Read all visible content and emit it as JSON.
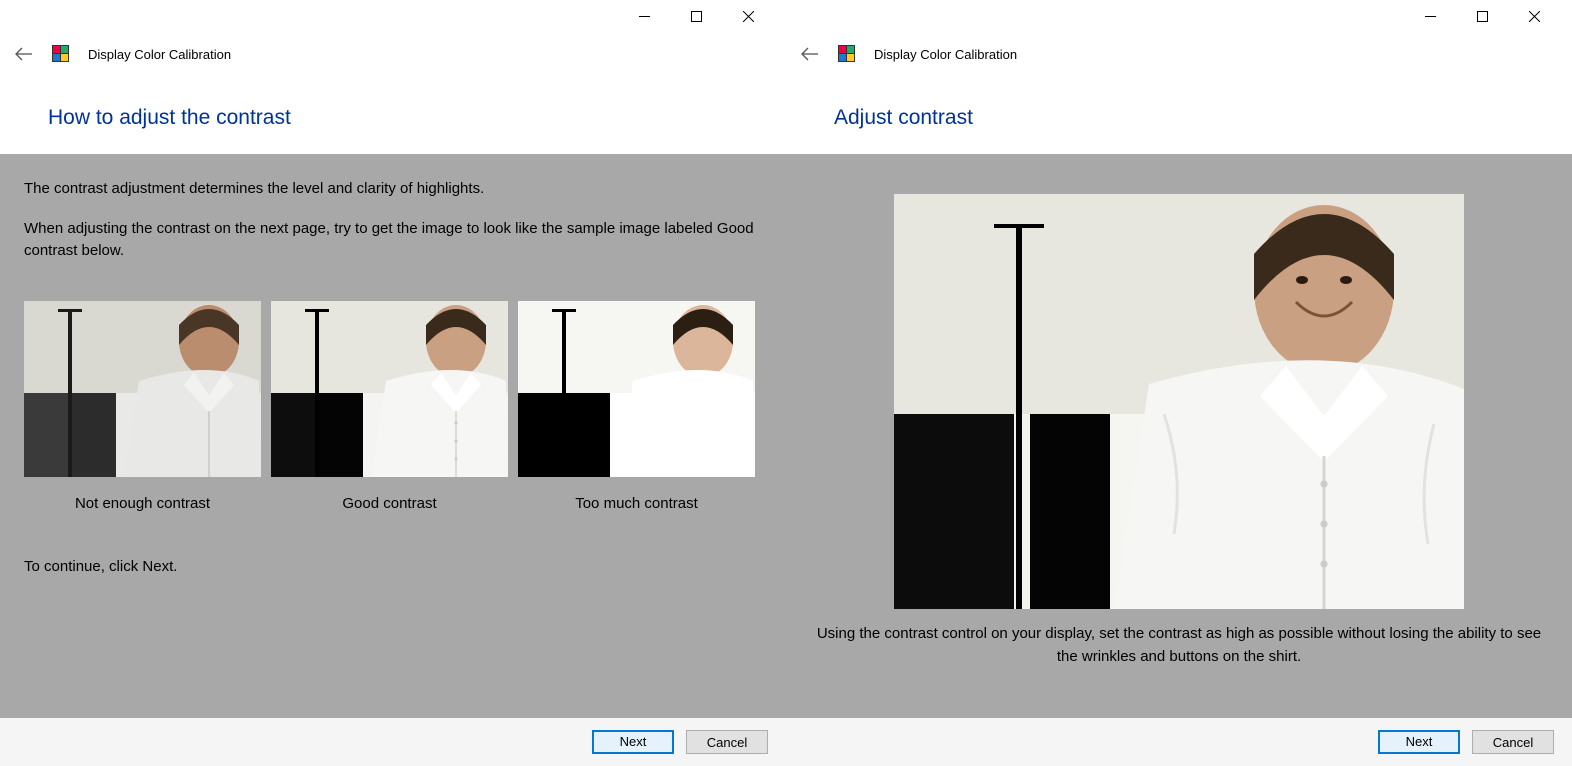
{
  "left": {
    "app_title": "Display Color Calibration",
    "heading": "How to adjust the contrast",
    "para1": "The contrast adjustment determines the level and clarity of highlights.",
    "para2": "When adjusting the contrast on the next page, try to get the image to look like the sample image labeled Good contrast below.",
    "samples": {
      "not_enough": "Not enough contrast",
      "good": "Good contrast",
      "too_much": "Too much contrast"
    },
    "continue_text": "To continue, click Next.",
    "next_label": "Next",
    "cancel_label": "Cancel"
  },
  "right": {
    "app_title": "Display Color Calibration",
    "heading": "Adjust contrast",
    "instruction": "Using the contrast control on your display, set the contrast as high as possible without losing the ability to see the wrinkles and buttons on the shirt.",
    "next_label": "Next",
    "cancel_label": "Cancel"
  }
}
